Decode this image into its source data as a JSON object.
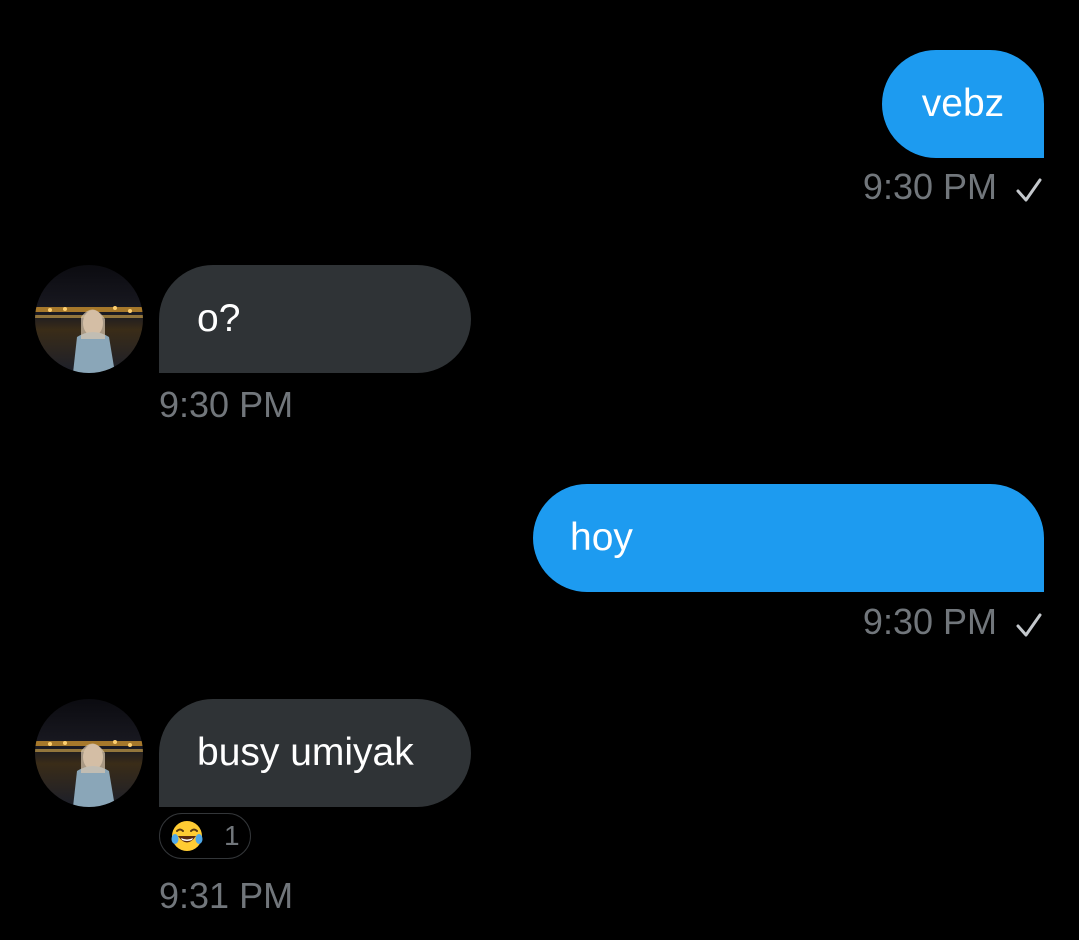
{
  "messages": [
    {
      "direction": "outgoing",
      "text": "vebz",
      "time": "9:30 PM",
      "status_icon": "check-icon"
    },
    {
      "direction": "incoming",
      "text": "o?",
      "time": "9:30 PM",
      "avatar": "sender-avatar"
    },
    {
      "direction": "outgoing",
      "text": "hoy",
      "time": "9:30 PM",
      "status_icon": "check-icon"
    },
    {
      "direction": "incoming",
      "text": "busy umiyak",
      "time": "9:31 PM",
      "avatar": "sender-avatar",
      "reaction": {
        "emoji": "face-with-tears-of-joy",
        "count": "1"
      }
    }
  ],
  "colors": {
    "background": "#000000",
    "outgoing_bubble": "#1d9bf0",
    "incoming_bubble": "#2f3336",
    "timestamp": "#71767b",
    "text": "#ffffff"
  }
}
